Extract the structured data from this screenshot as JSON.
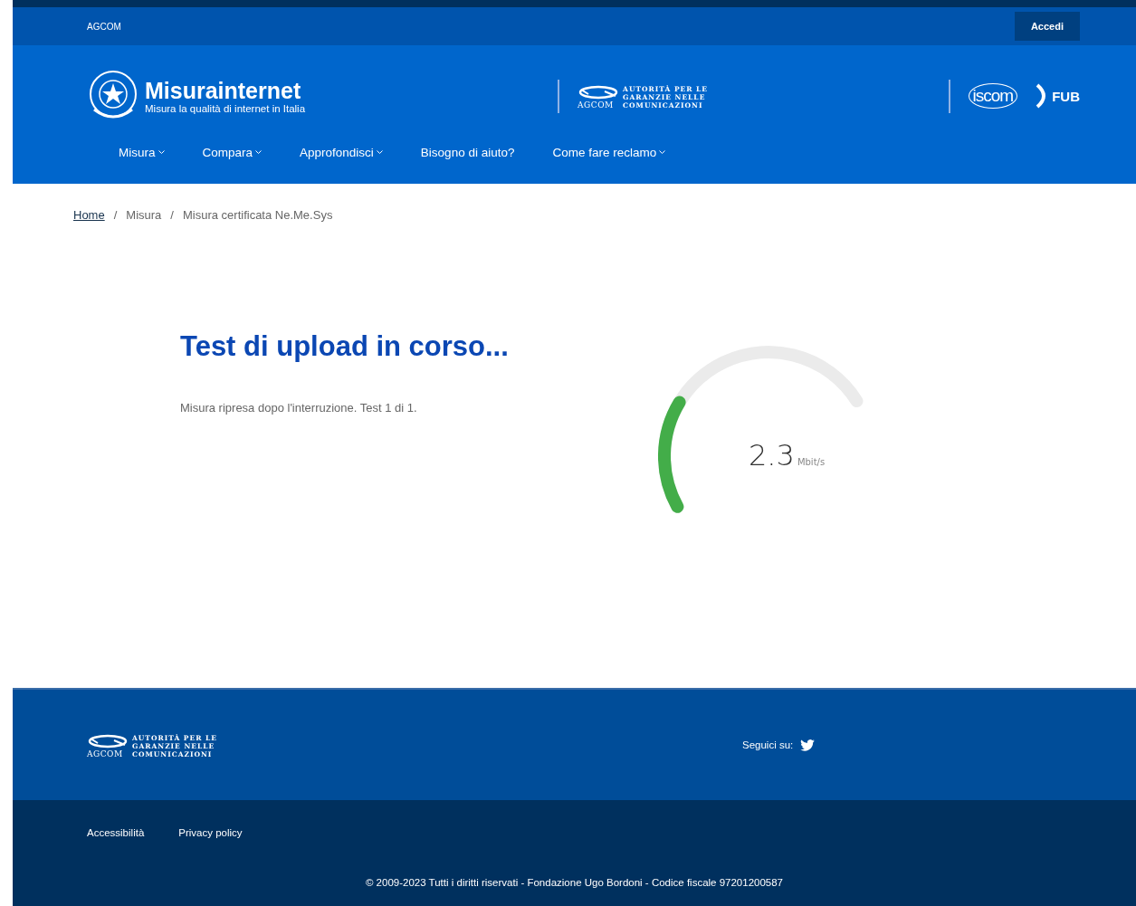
{
  "top_bar": {
    "label": "AGCOM",
    "login_button": "Accedi"
  },
  "header": {
    "site_title": "Misurainternet",
    "tagline": "Misura la qualità di internet in Italia",
    "agcom_logo": {
      "lines": [
        "AUTORITÀ PER LE",
        "GARANZIE NELLE",
        "COMUNICAZIONI"
      ],
      "acronym": "AGCOM"
    },
    "iscom_logo": "iscom",
    "fub_logo": "FUB"
  },
  "nav": [
    {
      "label": "Misura",
      "has_menu": true
    },
    {
      "label": "Compara",
      "has_menu": true
    },
    {
      "label": "Approfondisci",
      "has_menu": true
    },
    {
      "label": "Bisogno di aiuto?",
      "has_menu": false
    },
    {
      "label": "Come fare reclamo",
      "has_menu": true
    }
  ],
  "breadcrumb": [
    {
      "label": "Home",
      "link": true
    },
    {
      "separator": "/",
      "label": "Misura",
      "link": false
    },
    {
      "separator": "/",
      "label": "Misura certificata Ne.Me.Sys",
      "link": false
    }
  ],
  "test": {
    "title": "Test di upload in corso...",
    "message": "Misura ripresa dopo l'interruzione. Test 1 di 1."
  },
  "gauge": {
    "value": "2.3",
    "unit": "Mbit/s"
  },
  "footer": {
    "agcom_logo": {
      "lines": [
        "AUTORITÀ PER LE",
        "GARANZIE NELLE",
        "COMUNICAZIONI"
      ],
      "acronym": "AGCOM"
    },
    "follow_label": "Seguici su:",
    "links": [
      "Accessibilità",
      "Privacy policy"
    ],
    "copyright": "© 2009-2023 Tutti i diritti riservati - Fondazione Ugo Bordoni - Codice fiscale 97201200587"
  }
}
